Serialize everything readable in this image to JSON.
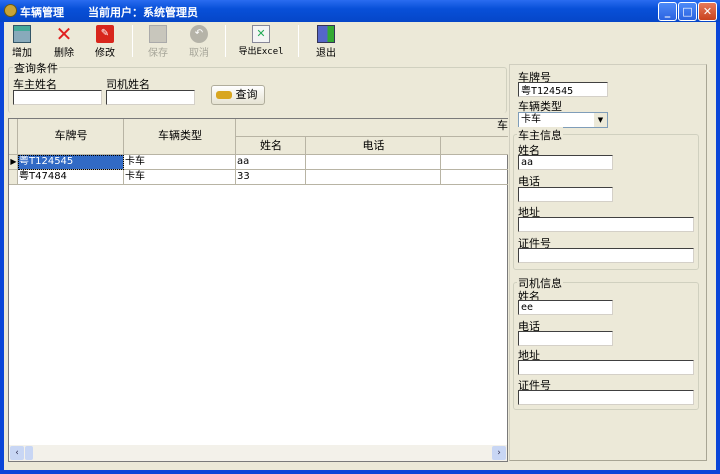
{
  "window": {
    "title": "车辆管理",
    "current_user": "当前用户：系统管理员",
    "controls": {
      "minimize": "_",
      "maximize": "□",
      "close": "✕"
    }
  },
  "toolbar": [
    {
      "label": "增加",
      "icon": "add-icon",
      "enabled": true
    },
    {
      "label": "删除",
      "icon": "delete-icon",
      "enabled": true
    },
    {
      "label": "修改",
      "icon": "edit-icon",
      "enabled": true
    },
    {
      "label": "保存",
      "icon": "save-icon",
      "enabled": false
    },
    {
      "label": "取消",
      "icon": "cancel-icon",
      "enabled": false
    },
    {
      "label": "导出Excel",
      "icon": "excel-icon",
      "enabled": true
    },
    {
      "label": "退出",
      "icon": "exit-icon",
      "enabled": true
    }
  ],
  "query": {
    "title": "查询条件",
    "owner_label": "车主姓名",
    "owner_value": "",
    "driver_label": "司机姓名",
    "driver_value": "",
    "button": "查询"
  },
  "grid": {
    "columns": [
      "车牌号",
      "车辆类型"
    ],
    "group_header": "车",
    "sub_columns": [
      "姓名",
      "电话",
      ""
    ],
    "rows": [
      {
        "plate": "粤T124545",
        "type": "卡车",
        "name": "aa",
        "phone": "",
        "extra": "",
        "selected": true
      },
      {
        "plate": "粤T47484",
        "type": "卡车",
        "name": "33",
        "phone": "",
        "extra": "",
        "selected": false
      }
    ]
  },
  "detail": {
    "plate_label": "车牌号",
    "plate_value": "粤T124545",
    "type_label": "车辆类型",
    "type_value": "卡车",
    "owner": {
      "title": "车主信息",
      "name_label": "姓名",
      "name_value": "aa",
      "phone_label": "电话",
      "phone_value": "",
      "address_label": "地址",
      "address_value": "",
      "id_label": "证件号",
      "id_value": ""
    },
    "driver": {
      "title": "司机信息",
      "name_label": "姓名",
      "name_value": "ee",
      "phone_label": "电话",
      "phone_value": "",
      "address_label": "地址",
      "address_value": "",
      "id_label": "证件号",
      "id_value": ""
    }
  },
  "colors": {
    "titlebar": "#0850d8",
    "face": "#ece9d8",
    "selection": "#316ac5"
  }
}
